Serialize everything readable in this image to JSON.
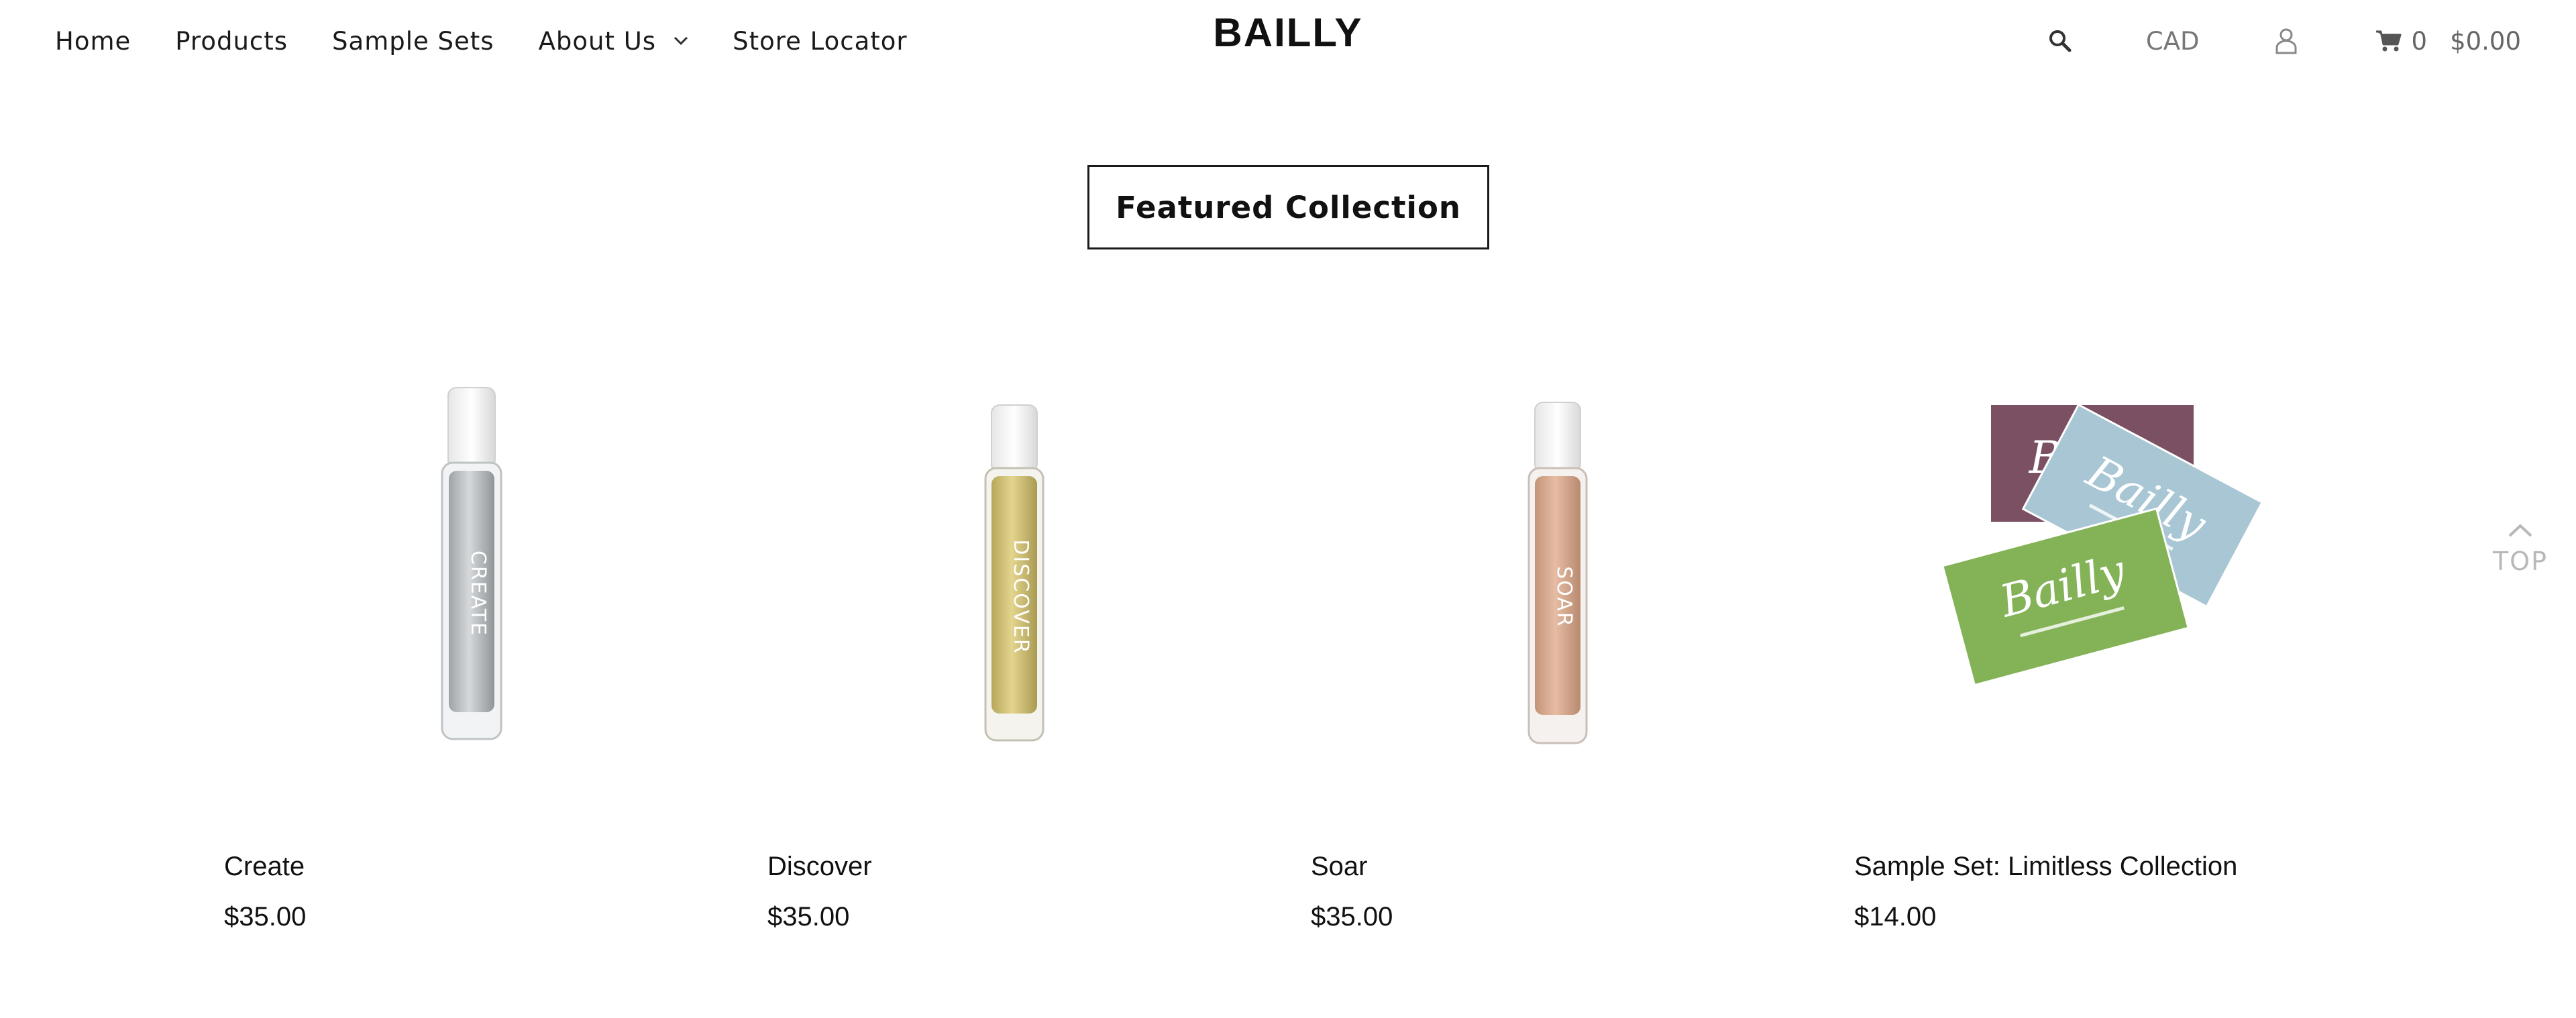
{
  "header": {
    "logo": "BAILLY",
    "nav": [
      {
        "label": "Home"
      },
      {
        "label": "Products"
      },
      {
        "label": "Sample Sets"
      },
      {
        "label": "About Us"
      },
      {
        "label": "Store Locator"
      }
    ],
    "currency": "CAD",
    "cart_count": "0",
    "cart_total": "$0.00"
  },
  "section": {
    "title": "Featured Collection"
  },
  "products": [
    {
      "name": "Create",
      "price": "$35.00",
      "bottle_label": "CREATE",
      "liquid_color": "#c9cdd0"
    },
    {
      "name": "Discover",
      "price": "$35.00",
      "bottle_label": "DISCOVER",
      "liquid_color": "#d9c97e"
    },
    {
      "name": "Soar",
      "price": "$35.00",
      "bottle_label": "SOAR",
      "liquid_color": "#dcae92"
    },
    {
      "name": "Sample Set: Limitless Collection",
      "price": "$14.00",
      "card_brand": "Bailly",
      "card_colors": [
        "#7b5063",
        "#a8c6d3",
        "#83b356"
      ]
    }
  ],
  "back_to_top": "TOP",
  "icons": [
    "search-icon",
    "user-icon",
    "cart-icon",
    "chevron-down-icon",
    "chevron-up-icon"
  ]
}
